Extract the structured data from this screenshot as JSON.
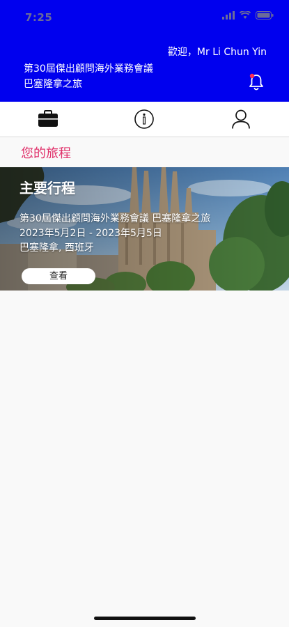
{
  "status_bar": {
    "time": "7:25"
  },
  "header": {
    "welcome": "歡迎，Mr Li Chun Yin",
    "event_title_line1": "第30屆傑出顧問海外業務會議",
    "event_title_line2": "巴塞隆拿之旅",
    "background_color": "#0000ee"
  },
  "tabs": [
    {
      "icon": "briefcase-icon",
      "active": true
    },
    {
      "icon": "info-icon",
      "active": false
    },
    {
      "icon": "profile-icon",
      "active": false
    }
  ],
  "section": {
    "title": "您的旅程",
    "color": "#e0306a"
  },
  "trip_card": {
    "heading": "主要行程",
    "event": "第30屆傑出顧問海外業務會議 巴塞隆拿之旅",
    "dates": "2023年5月2日 - 2023年5月5日",
    "location": "巴塞隆拿, 西班牙",
    "button_label": "查看"
  }
}
